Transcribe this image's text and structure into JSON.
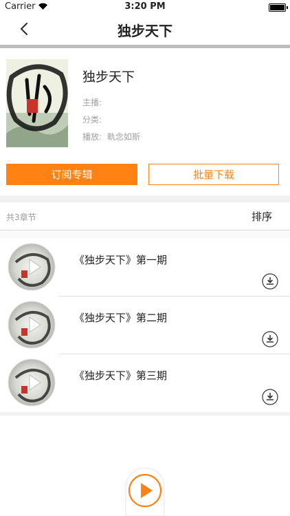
{
  "status": {
    "carrier": "Carrier",
    "time": "3:20 PM"
  },
  "nav": {
    "title": "独步天下"
  },
  "album": {
    "title": "独步天下",
    "host_label": "主播:",
    "category_label": "分类:",
    "plays_label": "播放:",
    "plays_value": "軌念如斯"
  },
  "actions": {
    "subscribe_label": "订阅专辑",
    "batch_download_label": "批量下载"
  },
  "list": {
    "count_label": "共3章节",
    "sort_label": "排序"
  },
  "tracks": [
    {
      "title": "《独步天下》第一期"
    },
    {
      "title": "《独步天下》第二期"
    },
    {
      "title": "《独步天下》第三期"
    }
  ],
  "colors": {
    "accent": "#ff8212",
    "divider": "#bdbdbd",
    "meta_text": "#a2a2a2"
  },
  "icons": [
    "back-chevron-icon",
    "wifi-icon",
    "battery-icon",
    "play-icon",
    "download-icon",
    "player-play-icon"
  ]
}
